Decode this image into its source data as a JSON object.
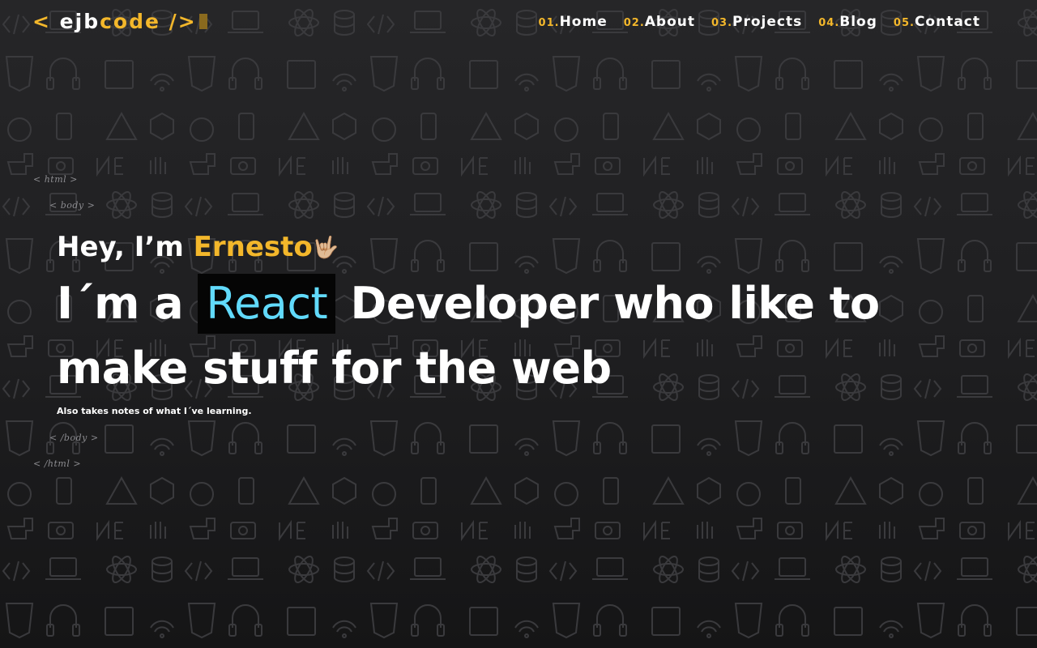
{
  "header": {
    "logo": {
      "open_bracket": "<",
      "main": "ejb",
      "accent": "code",
      "close_bracket": "/>"
    },
    "nav": [
      {
        "num": "01.",
        "label": "Home"
      },
      {
        "num": "02.",
        "label": "About"
      },
      {
        "num": "03.",
        "label": "Projects"
      },
      {
        "num": "04.",
        "label": "Blog"
      },
      {
        "num": "05.",
        "label": "Contact"
      }
    ]
  },
  "decor_tags": {
    "html_open": "< html >",
    "body_open": "< body >",
    "body_close": "< /body >",
    "html_close": "< /html >"
  },
  "hero": {
    "greeting_prefix": "Hey, I’m",
    "name": "Ernesto",
    "emoji": "🤟🏼",
    "headline_prefix": "I´m a",
    "tech": "React",
    "headline_suffix": "Developer who like to make stuff for the web",
    "subtitle": "Also takes notes of what I´ve learning."
  },
  "colors": {
    "accent": "#f3b72b",
    "react": "#61dafb",
    "background": "#1f1f21",
    "tag_gray": "#8c8c90"
  }
}
